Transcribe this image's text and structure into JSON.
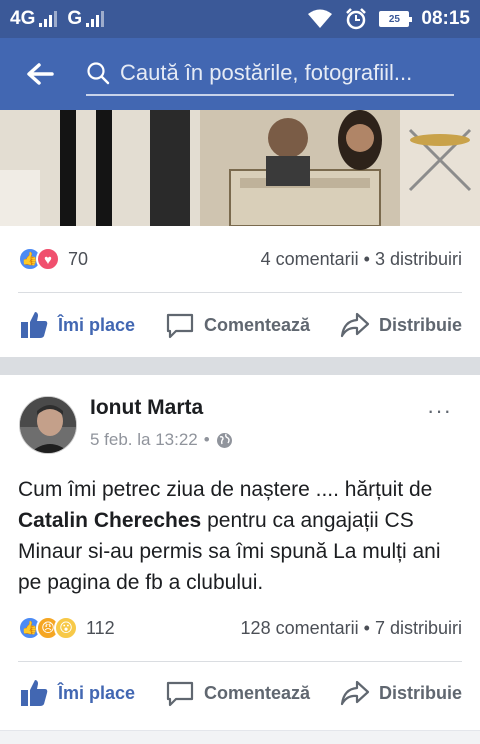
{
  "status_bar": {
    "network1": "4G",
    "network2": "G",
    "battery": "25",
    "time": "08:15"
  },
  "search": {
    "placeholder": "Caută în postările, fotografiil..."
  },
  "post1": {
    "reaction_count": "70",
    "comments": "4 comentarii",
    "separator": "•",
    "shares": "3 distribuiri"
  },
  "actions": {
    "like": "Îmi place",
    "comment": "Comentează",
    "share": "Distribuie"
  },
  "post2": {
    "author": "Ionut Marta",
    "date": "5 feb. la 13:22",
    "dot": "•",
    "more": "···",
    "text_before": "Cum îmi petrec ziua de naștere .... hărțuit de ",
    "mention": "Catalin Chereches",
    "text_after": " pentru ca angajații CS Minaur si-au permis sa îmi spună La mulți ani pe pagina de fb a clubului.",
    "reaction_count": "112",
    "comments": "128 comentarii",
    "separator": "•",
    "shares": "7 distribuiri"
  },
  "colors": {
    "status_bar": "#3b5998",
    "header": "#4267b2",
    "accent": "#4267b2"
  }
}
